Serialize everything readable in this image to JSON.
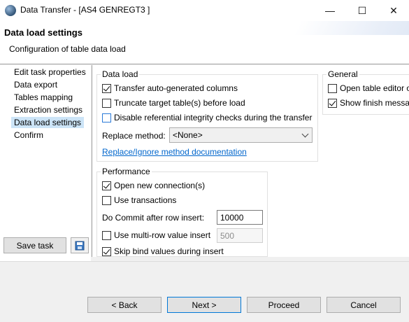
{
  "window": {
    "title": "Data Transfer - [AS4 GENREGT3 ]",
    "minimize_glyph": "—",
    "maximize_glyph": "☐",
    "close_glyph": "✕"
  },
  "header": {
    "title": "Data load settings",
    "description": "Configuration of table data load"
  },
  "nav": {
    "items": [
      {
        "label": "Edit task properties"
      },
      {
        "label": "Data export"
      },
      {
        "label": "Tables mapping"
      },
      {
        "label": "Extraction settings"
      },
      {
        "label": "Data load settings",
        "selected": true
      },
      {
        "label": "Confirm"
      }
    ],
    "save_task_label": "Save task",
    "save_icon": "floppy-save-icon"
  },
  "data_load": {
    "legend": "Data load",
    "transfer_autogen": {
      "label": "Transfer auto-generated columns",
      "checked": true
    },
    "truncate": {
      "label": "Truncate target table(s) before load",
      "checked": false
    },
    "disable_ri": {
      "label": "Disable referential integrity checks during the transfer",
      "checked": false
    },
    "replace_method_label": "Replace method:",
    "replace_method_value": "<None>",
    "doc_link": "Replace/Ignore method documentation"
  },
  "performance": {
    "legend": "Performance",
    "open_new_connection": {
      "label": "Open new connection(s)",
      "checked": true
    },
    "use_transactions": {
      "label": "Use transactions",
      "checked": false
    },
    "commit_label": "Do Commit after row insert:",
    "commit_value": "10000",
    "multi_row": {
      "label": "Use multi-row value insert",
      "checked": false
    },
    "multi_row_value": "500",
    "skip_bind": {
      "label": "Skip bind values during insert",
      "checked": true
    }
  },
  "general": {
    "legend": "General",
    "open_table_editor": {
      "label": "Open table editor o",
      "checked": false
    },
    "show_finish": {
      "label": "Show finish messag",
      "checked": true
    }
  },
  "footer": {
    "back_label": "< Back",
    "next_label": "Next >",
    "proceed_label": "Proceed",
    "cancel_label": "Cancel"
  }
}
